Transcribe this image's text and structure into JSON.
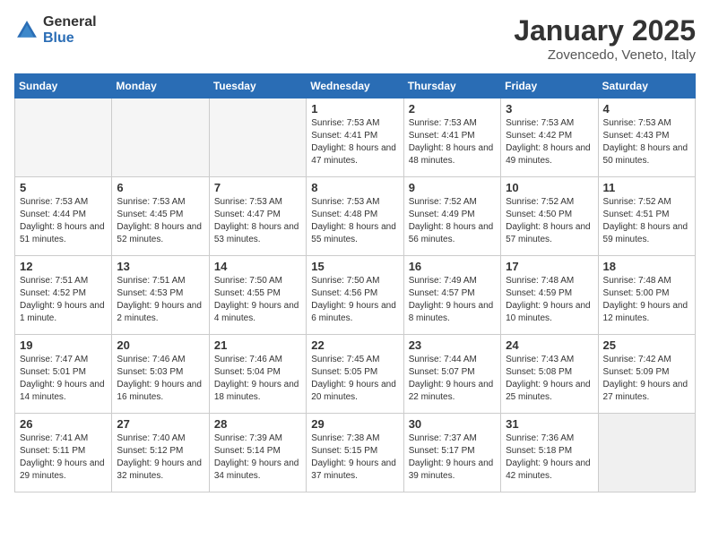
{
  "header": {
    "logo_general": "General",
    "logo_blue": "Blue",
    "month_title": "January 2025",
    "location": "Zovencedo, Veneto, Italy"
  },
  "days_of_week": [
    "Sunday",
    "Monday",
    "Tuesday",
    "Wednesday",
    "Thursday",
    "Friday",
    "Saturday"
  ],
  "weeks": [
    [
      {
        "day": "",
        "empty": true
      },
      {
        "day": "",
        "empty": true
      },
      {
        "day": "",
        "empty": true
      },
      {
        "day": "1",
        "sunrise": "7:53 AM",
        "sunset": "4:41 PM",
        "daylight": "8 hours and 47 minutes."
      },
      {
        "day": "2",
        "sunrise": "7:53 AM",
        "sunset": "4:41 PM",
        "daylight": "8 hours and 48 minutes."
      },
      {
        "day": "3",
        "sunrise": "7:53 AM",
        "sunset": "4:42 PM",
        "daylight": "8 hours and 49 minutes."
      },
      {
        "day": "4",
        "sunrise": "7:53 AM",
        "sunset": "4:43 PM",
        "daylight": "8 hours and 50 minutes."
      }
    ],
    [
      {
        "day": "5",
        "sunrise": "7:53 AM",
        "sunset": "4:44 PM",
        "daylight": "8 hours and 51 minutes."
      },
      {
        "day": "6",
        "sunrise": "7:53 AM",
        "sunset": "4:45 PM",
        "daylight": "8 hours and 52 minutes."
      },
      {
        "day": "7",
        "sunrise": "7:53 AM",
        "sunset": "4:47 PM",
        "daylight": "8 hours and 53 minutes."
      },
      {
        "day": "8",
        "sunrise": "7:53 AM",
        "sunset": "4:48 PM",
        "daylight": "8 hours and 55 minutes."
      },
      {
        "day": "9",
        "sunrise": "7:52 AM",
        "sunset": "4:49 PM",
        "daylight": "8 hours and 56 minutes."
      },
      {
        "day": "10",
        "sunrise": "7:52 AM",
        "sunset": "4:50 PM",
        "daylight": "8 hours and 57 minutes."
      },
      {
        "day": "11",
        "sunrise": "7:52 AM",
        "sunset": "4:51 PM",
        "daylight": "8 hours and 59 minutes."
      }
    ],
    [
      {
        "day": "12",
        "sunrise": "7:51 AM",
        "sunset": "4:52 PM",
        "daylight": "9 hours and 1 minute."
      },
      {
        "day": "13",
        "sunrise": "7:51 AM",
        "sunset": "4:53 PM",
        "daylight": "9 hours and 2 minutes."
      },
      {
        "day": "14",
        "sunrise": "7:50 AM",
        "sunset": "4:55 PM",
        "daylight": "9 hours and 4 minutes."
      },
      {
        "day": "15",
        "sunrise": "7:50 AM",
        "sunset": "4:56 PM",
        "daylight": "9 hours and 6 minutes."
      },
      {
        "day": "16",
        "sunrise": "7:49 AM",
        "sunset": "4:57 PM",
        "daylight": "9 hours and 8 minutes."
      },
      {
        "day": "17",
        "sunrise": "7:48 AM",
        "sunset": "4:59 PM",
        "daylight": "9 hours and 10 minutes."
      },
      {
        "day": "18",
        "sunrise": "7:48 AM",
        "sunset": "5:00 PM",
        "daylight": "9 hours and 12 minutes."
      }
    ],
    [
      {
        "day": "19",
        "sunrise": "7:47 AM",
        "sunset": "5:01 PM",
        "daylight": "9 hours and 14 minutes."
      },
      {
        "day": "20",
        "sunrise": "7:46 AM",
        "sunset": "5:03 PM",
        "daylight": "9 hours and 16 minutes."
      },
      {
        "day": "21",
        "sunrise": "7:46 AM",
        "sunset": "5:04 PM",
        "daylight": "9 hours and 18 minutes."
      },
      {
        "day": "22",
        "sunrise": "7:45 AM",
        "sunset": "5:05 PM",
        "daylight": "9 hours and 20 minutes."
      },
      {
        "day": "23",
        "sunrise": "7:44 AM",
        "sunset": "5:07 PM",
        "daylight": "9 hours and 22 minutes."
      },
      {
        "day": "24",
        "sunrise": "7:43 AM",
        "sunset": "5:08 PM",
        "daylight": "9 hours and 25 minutes."
      },
      {
        "day": "25",
        "sunrise": "7:42 AM",
        "sunset": "5:09 PM",
        "daylight": "9 hours and 27 minutes."
      }
    ],
    [
      {
        "day": "26",
        "sunrise": "7:41 AM",
        "sunset": "5:11 PM",
        "daylight": "9 hours and 29 minutes."
      },
      {
        "day": "27",
        "sunrise": "7:40 AM",
        "sunset": "5:12 PM",
        "daylight": "9 hours and 32 minutes."
      },
      {
        "day": "28",
        "sunrise": "7:39 AM",
        "sunset": "5:14 PM",
        "daylight": "9 hours and 34 minutes."
      },
      {
        "day": "29",
        "sunrise": "7:38 AM",
        "sunset": "5:15 PM",
        "daylight": "9 hours and 37 minutes."
      },
      {
        "day": "30",
        "sunrise": "7:37 AM",
        "sunset": "5:17 PM",
        "daylight": "9 hours and 39 minutes."
      },
      {
        "day": "31",
        "sunrise": "7:36 AM",
        "sunset": "5:18 PM",
        "daylight": "9 hours and 42 minutes."
      },
      {
        "day": "",
        "empty": true,
        "shaded": true
      }
    ]
  ]
}
